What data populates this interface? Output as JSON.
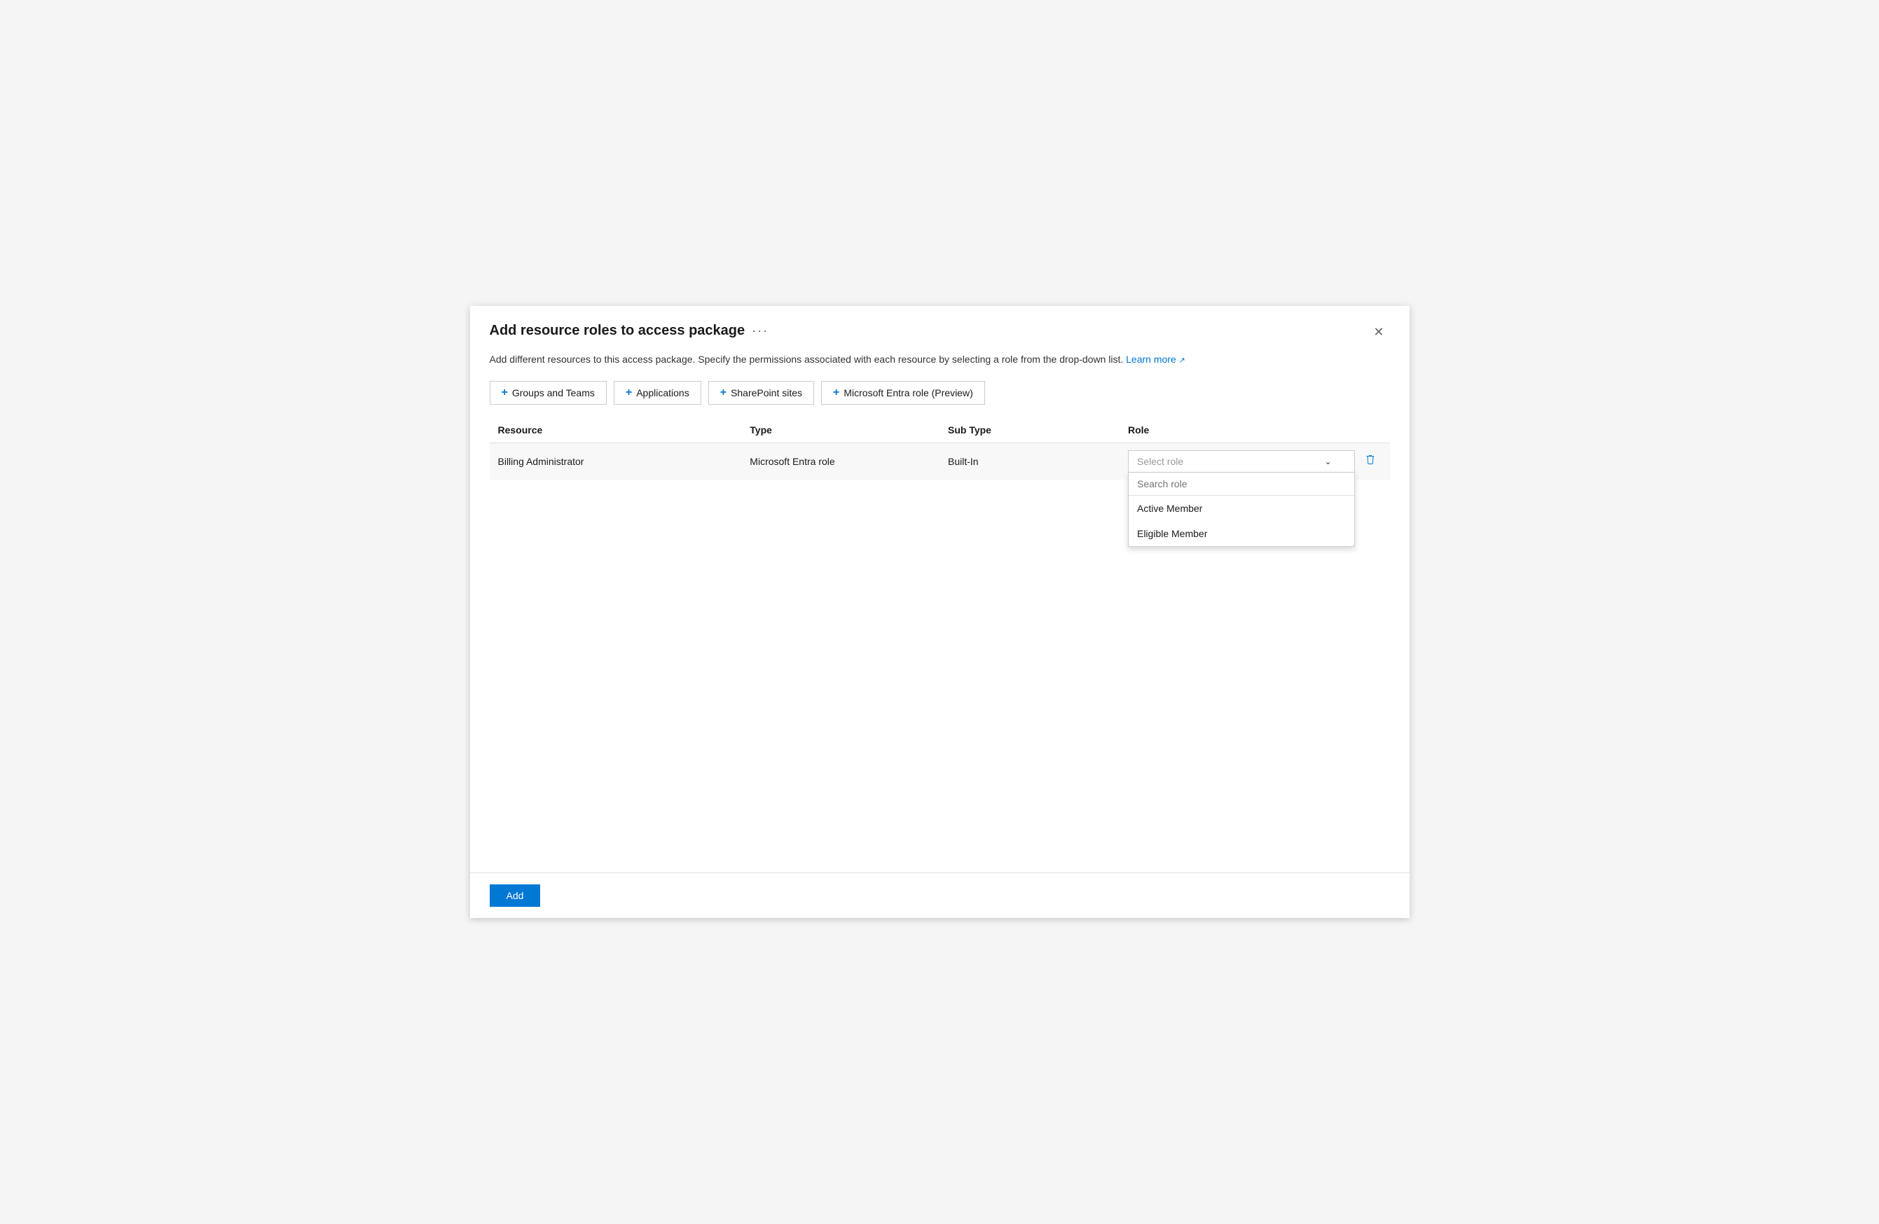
{
  "dialog": {
    "title": "Add resource roles to access package",
    "more_label": "···",
    "description": "Add different resources to this access package. Specify the permissions associated with each resource by selecting a role from the drop-down list.",
    "learn_more_label": "Learn more",
    "close_label": "✕"
  },
  "toolbar": {
    "buttons": [
      {
        "id": "groups-teams",
        "label": "Groups and Teams"
      },
      {
        "id": "applications",
        "label": "Applications"
      },
      {
        "id": "sharepoint-sites",
        "label": "SharePoint sites"
      },
      {
        "id": "entra-role",
        "label": "Microsoft Entra role (Preview)"
      }
    ]
  },
  "table": {
    "columns": [
      {
        "id": "resource",
        "label": "Resource"
      },
      {
        "id": "type",
        "label": "Type"
      },
      {
        "id": "subtype",
        "label": "Sub Type"
      },
      {
        "id": "role",
        "label": "Role"
      }
    ],
    "rows": [
      {
        "resource": "Billing Administrator",
        "type": "Microsoft Entra role",
        "subtype": "Built-In",
        "role_placeholder": "Select role"
      }
    ]
  },
  "dropdown": {
    "search_placeholder": "Search role",
    "items": [
      {
        "label": "Active Member"
      },
      {
        "label": "Eligible Member"
      }
    ]
  },
  "footer": {
    "add_label": "Add"
  }
}
